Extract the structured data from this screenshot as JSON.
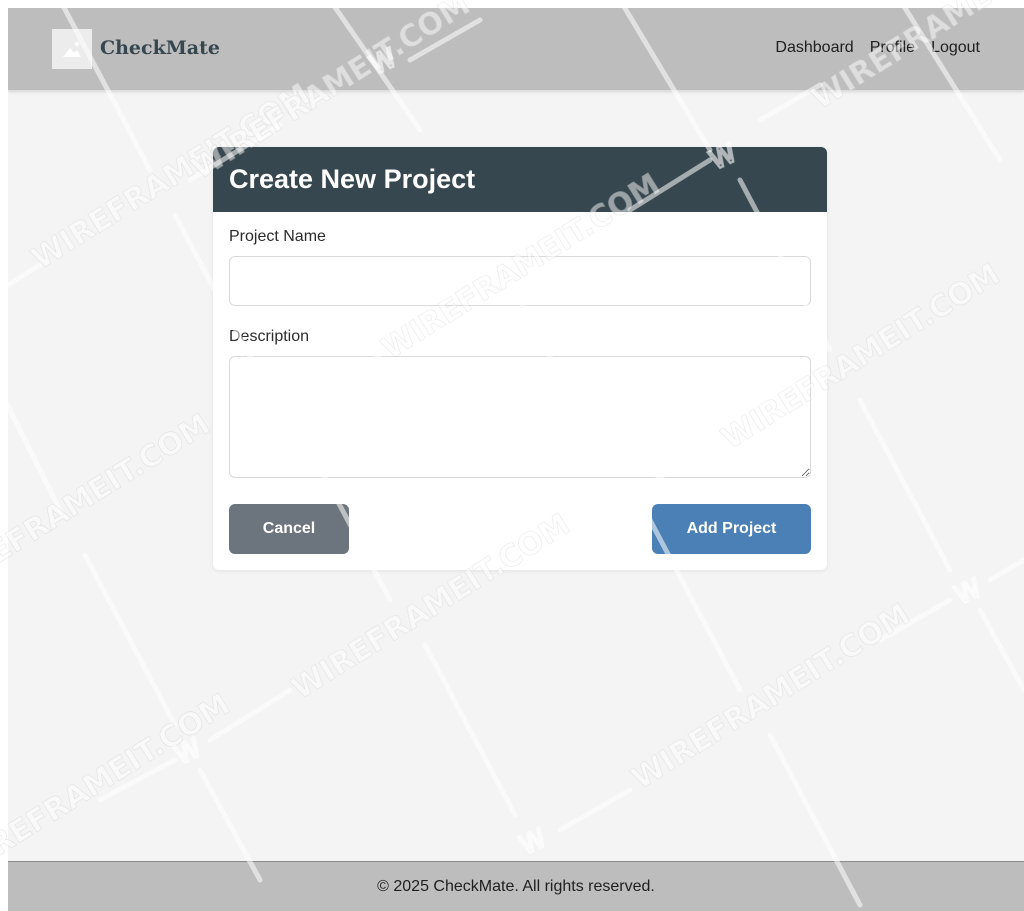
{
  "app": {
    "brand": "CheckMate",
    "logo_icon": "image-placeholder-icon"
  },
  "nav": {
    "items": [
      {
        "label": "Dashboard"
      },
      {
        "label": "Profile"
      },
      {
        "label": "Logout"
      }
    ]
  },
  "form": {
    "title": "Create New Project",
    "project_name_label": "Project Name",
    "project_name_value": "",
    "description_label": "Description",
    "description_value": "",
    "cancel_label": "Cancel",
    "submit_label": "Add Project"
  },
  "footer": {
    "text": "© 2025 CheckMate. All rights reserved."
  },
  "watermark": {
    "text": "WIREFRAMEIT.COM",
    "mark": "W"
  },
  "colors": {
    "header_bg": "#bdbdbd",
    "card_header_bg": "#37474f",
    "cancel_bg": "#6c757d",
    "submit_bg": "#4a80b5",
    "page_bg": "#f4f4f4"
  }
}
